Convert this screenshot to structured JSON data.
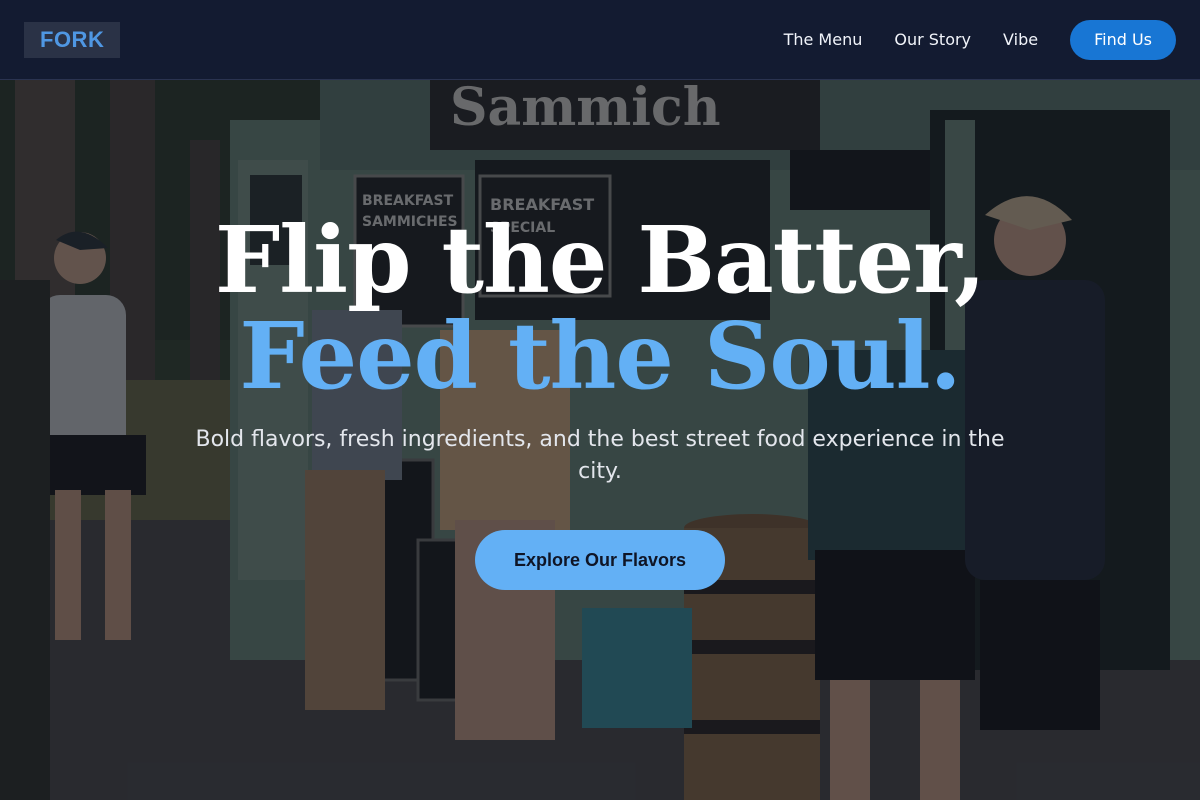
{
  "nav": {
    "logo": "FORK",
    "links": [
      "The Menu",
      "Our Story",
      "Vibe"
    ],
    "cta": "Find Us"
  },
  "hero": {
    "headline_line1": "Flip the Batter,",
    "headline_line2": "Feed the Soul.",
    "subtitle": "Bold flavors, fresh ingredients, and the best street food experience in the city.",
    "cta": "Explore Our Flavors",
    "truck_signs": [
      "BREAKFAST SAMMICHES",
      "BREAKFAST SPECIAL"
    ]
  },
  "colors": {
    "nav_bg": "#131b31",
    "accent": "#63b0f5",
    "nav_cta": "#1876d4"
  }
}
